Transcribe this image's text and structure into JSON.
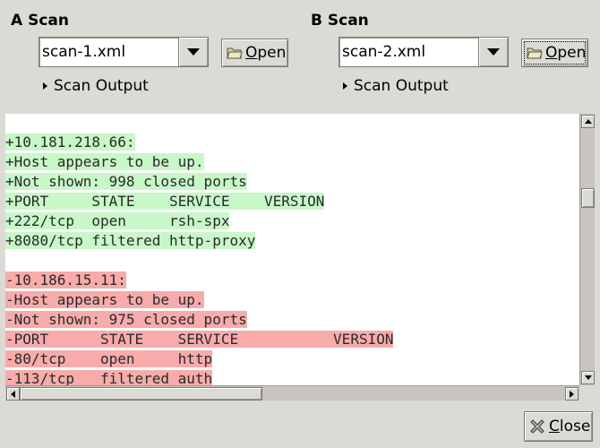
{
  "scan_a": {
    "heading": "A Scan",
    "file": "scan-1.xml",
    "open_label": "Open",
    "expander_label": "Scan Output"
  },
  "scan_b": {
    "heading": "B Scan",
    "file": "scan-2.xml",
    "open_label": "Open",
    "expander_label": "Scan Output"
  },
  "diff": {
    "added": [
      "+10.181.218.66:",
      "+Host appears to be up.",
      "+Not shown: 998 closed ports",
      "+PORT     STATE    SERVICE    VERSION",
      "+222/tcp  open     rsh-spx",
      "+8080/tcp filtered http-proxy"
    ],
    "removed": [
      "-10.186.15.11:",
      "-Host appears to be up.",
      "-Not shown: 975 closed ports",
      "-PORT      STATE    SERVICE           VERSION",
      "-80/tcp    open     http",
      "-113/tcp   filtered auth"
    ]
  },
  "footer": {
    "close_label": "Close"
  },
  "colors": {
    "added_bg": "#c8f7c8",
    "removed_bg": "#f7abab",
    "window_bg": "#dcdad5"
  }
}
